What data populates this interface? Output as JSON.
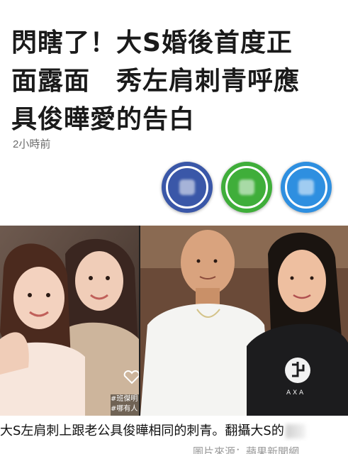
{
  "article": {
    "headline_lines": [
      "閃瞎了！大S婚後首度正",
      "面露面　秀左肩刺青呼應",
      "具俊曄愛的告白"
    ],
    "timestamp": "2小時前"
  },
  "share": {
    "buttons": [
      {
        "icon": "facebook-icon",
        "color": "#3a57a8"
      },
      {
        "icon": "line-icon",
        "color": "#3fae3a"
      },
      {
        "icon": "share-icon",
        "color": "#2e8fe0"
      }
    ]
  },
  "photo": {
    "left_overlay_text_1": "#班傑明",
    "left_overlay_text_2": "#哪有人"
  },
  "caption": {
    "text": "大S左肩刺上跟老公具俊曄相同的刺青。翻攝大S的",
    "source_partial": "圖片來源：蘋果新聞網"
  }
}
